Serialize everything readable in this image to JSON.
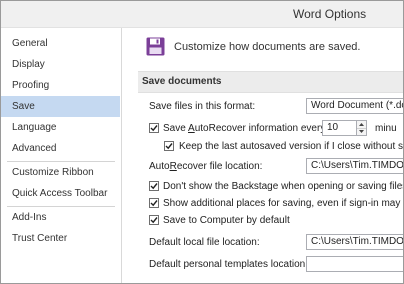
{
  "window": {
    "title": "Word Options"
  },
  "sidebar": {
    "items": [
      {
        "label": "General"
      },
      {
        "label": "Display"
      },
      {
        "label": "Proofing"
      },
      {
        "label": "Save",
        "selected": true
      },
      {
        "label": "Language"
      },
      {
        "label": "Advanced"
      },
      {
        "label": "Customize Ribbon"
      },
      {
        "label": "Quick Access Toolbar"
      },
      {
        "label": "Add-Ins"
      },
      {
        "label": "Trust Center"
      }
    ]
  },
  "header": {
    "icon": "floppy-disk-icon",
    "text": "Customize how documents are saved."
  },
  "save_documents": {
    "section_title": "Save documents",
    "format_label": "Save files in this format:",
    "format_value": "Word Document (*.doc",
    "autorecover_label_before": "Save ",
    "autorecover_label_accel": "A",
    "autorecover_label_after": "utoRecover information every",
    "autorecover_checked": true,
    "autorecover_minutes": "10",
    "minutes_label": "minu",
    "keep_last_label": "Keep the last autosaved version if I close without savin",
    "keep_last_checked": true,
    "autorecover_location_label_before": "Auto",
    "autorecover_location_label_accel": "R",
    "autorecover_location_label_after": "ecover file location:",
    "autorecover_location_value": "C:\\Users\\Tim.TIMDOM",
    "backstage_label": "Don't show the Backstage when opening or saving files",
    "backstage_checked": true,
    "additional_places_label": "Show additional places for saving, even if sign-in may be",
    "additional_places_checked": true,
    "save_to_computer_label": "Save to Computer by default",
    "save_to_computer_checked": true,
    "default_local_label": "Default local file location:",
    "default_local_value": "C:\\Users\\Tim.TIMDOM",
    "templates_label": "Default personal templates location:",
    "templates_value": ""
  },
  "colors": {
    "selected_nav": "#c5d9f1",
    "floppy": "#7b3f98"
  }
}
